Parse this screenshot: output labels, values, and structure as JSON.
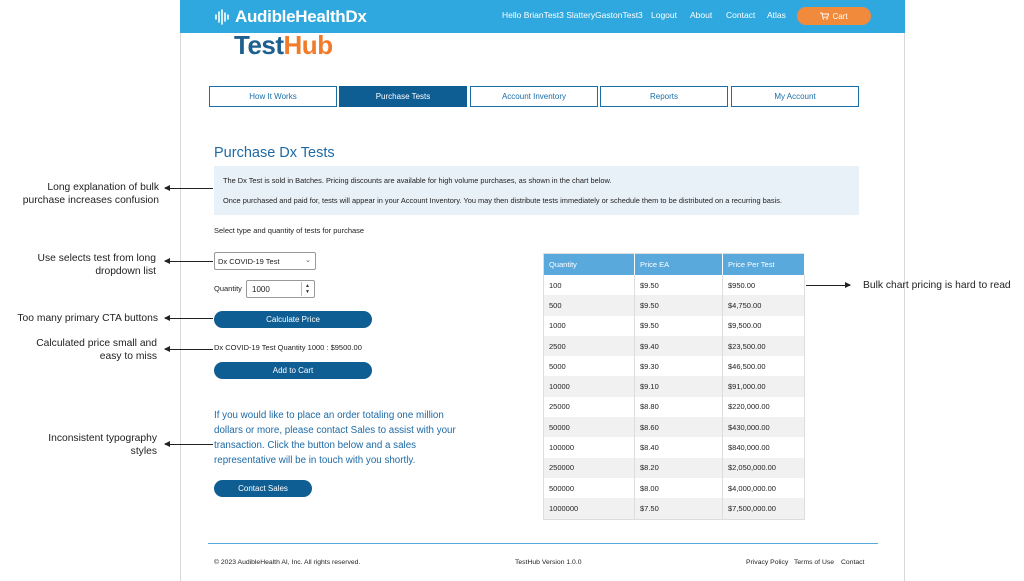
{
  "header": {
    "brand_main": "AudibleHealth",
    "brand_suffix": "Dx",
    "greeting": "Hello BrianTest3 SlatteryGastonTest3",
    "nav": [
      "Logout",
      "About",
      "Contact",
      "Atlas"
    ],
    "cart_label": "Cart",
    "cart_icon": "cart-icon"
  },
  "logo": {
    "part1": "Test",
    "part2": "Hub"
  },
  "tabs": [
    "How It Works",
    "Purchase Tests",
    "Account Inventory",
    "Reports",
    "My Account"
  ],
  "active_tab": "Purchase Tests",
  "page": {
    "title": "Purchase Dx Tests",
    "info_line1": "The Dx Test is sold in Batches. Pricing discounts are available for high volume purchases, as shown in the chart below.",
    "info_line2": "Once purchased and paid for, tests will appear in your Account Inventory. You may then distribute tests immediately or schedule them to be distributed on a recurring basis.",
    "select_instruction": "Select type and quantity of tests for purchase",
    "test_select_value": "Dx COVID-19 Test",
    "quantity_label": "Quantity",
    "quantity_value": "1000",
    "calculate_button": "Calculate Price",
    "calculated_text": "Dx COVID-19 Test Quantity 1000 : $9500.00",
    "add_to_cart_button": "Add to Cart",
    "sales_message": "If you would like to place an order totaling one million dollars or more, please contact Sales to assist with your transaction. Click the button below and a sales representative will be in touch with you shortly.",
    "contact_sales_button": "Contact Sales"
  },
  "price_table": {
    "headers": [
      "Quantity",
      "Price EA",
      "Price Per Test"
    ],
    "rows": [
      [
        "100",
        "$9.50",
        "$950.00"
      ],
      [
        "500",
        "$9.50",
        "$4,750.00"
      ],
      [
        "1000",
        "$9.50",
        "$9,500.00"
      ],
      [
        "2500",
        "$9.40",
        "$23,500.00"
      ],
      [
        "5000",
        "$9.30",
        "$46,500.00"
      ],
      [
        "10000",
        "$9.10",
        "$91,000.00"
      ],
      [
        "25000",
        "$8.80",
        "$220,000.00"
      ],
      [
        "50000",
        "$8.60",
        "$430,000.00"
      ],
      [
        "100000",
        "$8.40",
        "$840,000.00"
      ],
      [
        "250000",
        "$8.20",
        "$2,050,000.00"
      ],
      [
        "500000",
        "$8.00",
        "$4,000,000.00"
      ],
      [
        "1000000",
        "$7.50",
        "$7,500,000.00"
      ]
    ]
  },
  "footer": {
    "copyright": "© 2023 AudibleHealth AI, Inc. All rights reserved.",
    "version": "TestHub Version 1.0.0",
    "links": [
      "Privacy Policy",
      "Terms of Use",
      "Contact"
    ]
  },
  "annotations": {
    "a1": [
      "Long explanation of bulk",
      "purchase increases confusion"
    ],
    "a2": [
      "Use selects test from long",
      "dropdown list"
    ],
    "a3": [
      "Too many primary CTA buttons"
    ],
    "a4": [
      "Calculated price small and",
      "easy to miss"
    ],
    "a5": [
      "Inconsistent typography",
      "styles"
    ],
    "a6": "Bulk chart pricing is hard to read"
  },
  "colors": {
    "topbar": "#2ea8df",
    "primary": "#0f5e93",
    "accent": "#f28a3c",
    "heading": "#1d6aa5"
  }
}
